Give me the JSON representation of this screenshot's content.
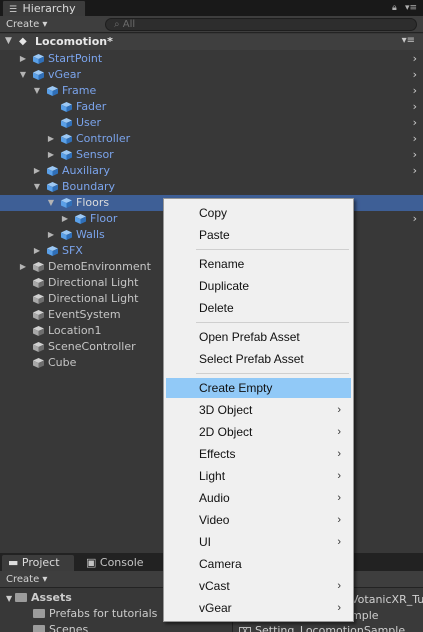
{
  "hierarchy_panel": {
    "tab_label": "Hierarchy",
    "create_label": "Create ▾",
    "search_placeholder": "All",
    "lock_icon": "lock-icon",
    "menu_icon": "kebab-menu-icon"
  },
  "scene": {
    "name": "Locomotion*",
    "menu_glyph": "▾≡"
  },
  "tree": [
    {
      "label": "StartPoint",
      "depth": 1,
      "fold": "collapsed",
      "color": "blue",
      "has_arrow": true
    },
    {
      "label": "vGear",
      "depth": 1,
      "fold": "expanded",
      "color": "blue",
      "has_arrow": true
    },
    {
      "label": "Frame",
      "depth": 2,
      "fold": "expanded",
      "color": "blue",
      "has_arrow": true
    },
    {
      "label": "Fader",
      "depth": 3,
      "fold": "none",
      "color": "blue",
      "has_arrow": true
    },
    {
      "label": "User",
      "depth": 3,
      "fold": "none",
      "color": "blue",
      "has_arrow": true
    },
    {
      "label": "Controller",
      "depth": 3,
      "fold": "collapsed",
      "color": "blue",
      "has_arrow": true
    },
    {
      "label": "Sensor",
      "depth": 3,
      "fold": "collapsed",
      "color": "blue",
      "has_arrow": true
    },
    {
      "label": "Auxiliary",
      "depth": 2,
      "fold": "collapsed",
      "color": "blue",
      "has_arrow": true
    },
    {
      "label": "Boundary",
      "depth": 2,
      "fold": "expanded",
      "color": "blue",
      "has_arrow": false
    },
    {
      "label": "Floors",
      "depth": 3,
      "fold": "expanded",
      "color": "blue",
      "has_arrow": false,
      "selected": true
    },
    {
      "label": "Floor",
      "depth": 4,
      "fold": "collapsed",
      "color": "blue",
      "has_arrow": true
    },
    {
      "label": "Walls",
      "depth": 3,
      "fold": "collapsed",
      "color": "blue",
      "has_arrow": false
    },
    {
      "label": "SFX",
      "depth": 2,
      "fold": "collapsed",
      "color": "blue",
      "has_arrow": false
    },
    {
      "label": "DemoEnvironment",
      "depth": 1,
      "fold": "collapsed",
      "color": "plain",
      "has_arrow": false
    },
    {
      "label": "Directional Light",
      "depth": 1,
      "fold": "none",
      "color": "plain",
      "has_arrow": false
    },
    {
      "label": "Directional Light",
      "depth": 1,
      "fold": "none",
      "color": "plain",
      "has_arrow": false
    },
    {
      "label": "EventSystem",
      "depth": 1,
      "fold": "none",
      "color": "plain",
      "has_arrow": false
    },
    {
      "label": "Location1",
      "depth": 1,
      "fold": "none",
      "color": "plain",
      "has_arrow": false
    },
    {
      "label": "SceneController",
      "depth": 1,
      "fold": "none",
      "color": "plain",
      "has_arrow": false
    },
    {
      "label": "Cube",
      "depth": 1,
      "fold": "none",
      "color": "plain",
      "has_arrow": false
    }
  ],
  "context_menu": {
    "items": [
      {
        "label": "Copy"
      },
      {
        "label": "Paste",
        "separator_after": true
      },
      {
        "label": "Rename"
      },
      {
        "label": "Duplicate"
      },
      {
        "label": "Delete",
        "separator_after": true
      },
      {
        "label": "Open Prefab Asset"
      },
      {
        "label": "Select Prefab Asset",
        "separator_after": true
      },
      {
        "label": "Create Empty",
        "highlighted": true
      },
      {
        "label": "3D Object",
        "submenu": true
      },
      {
        "label": "2D Object",
        "submenu": true
      },
      {
        "label": "Effects",
        "submenu": true
      },
      {
        "label": "Light",
        "submenu": true
      },
      {
        "label": "Audio",
        "submenu": true
      },
      {
        "label": "Video",
        "submenu": true
      },
      {
        "label": "UI",
        "submenu": true
      },
      {
        "label": "Camera"
      },
      {
        "label": "vCast",
        "submenu": true
      },
      {
        "label": "vGear",
        "submenu": true
      }
    ]
  },
  "bottom_panel": {
    "project_tab": "Project",
    "console_tab": "Console",
    "create_label": "Create ▾",
    "folders": [
      "Assets",
      "Prefabs for tutorials",
      "Scenes"
    ],
    "right_lines": [
      "VotanicXR_Tu",
      "mple",
      "Setting_LocomotionSample"
    ]
  },
  "colors": {
    "selection": "#3e5f96",
    "menu_highlight": "#91c9f7",
    "prefab_text": "#7ba4ec"
  }
}
